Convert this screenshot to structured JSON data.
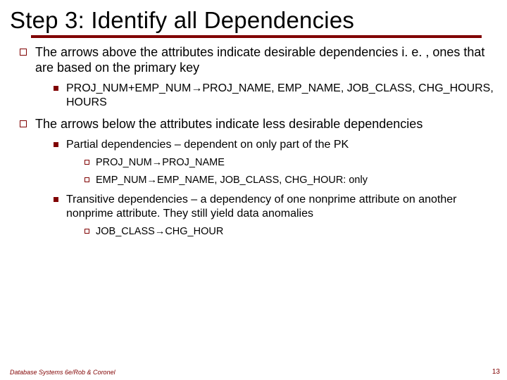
{
  "title": "Step 3: Identify all Dependencies",
  "bullets": {
    "b1": {
      "text": "The arrows above the attributes indicate desirable dependencies i. e. , ones that are based on the primary key",
      "s1": "PROJ_NUM+EMP_NUM→PROJ_NAME, EMP_NAME, JOB_CLASS, CHG_HOURS, HOURS"
    },
    "b2": {
      "text": "The arrows below the attributes indicate less desirable dependencies",
      "s1": {
        "text": "Partial dependencies – dependent on only part of the PK",
        "d1": "PROJ_NUM→PROJ_NAME",
        "d2": "EMP_NUM→EMP_NAME, JOB_CLASS, CHG_HOUR: only"
      },
      "s2": {
        "text": "Transitive dependencies – a dependency of one nonprime attribute on another nonprime attribute. They still yield data anomalies",
        "d1": "JOB_CLASS→CHG_HOUR"
      }
    }
  },
  "footer": "Database Systems 6e/Rob & Coronel",
  "page": "13"
}
